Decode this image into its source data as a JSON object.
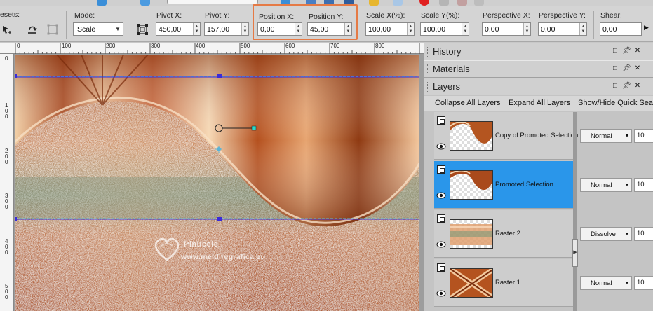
{
  "toolbar": {
    "presets_label": "esets:",
    "mode_label": "Mode:",
    "mode_value": "Scale",
    "fields": [
      {
        "label": "Pivot X:",
        "value": "450,00"
      },
      {
        "label": "Pivot Y:",
        "value": "157,00"
      },
      {
        "label": "Position X:",
        "value": "0,00"
      },
      {
        "label": "Position Y:",
        "value": "45,00"
      },
      {
        "label": "Scale X(%):",
        "value": "100,00"
      },
      {
        "label": "Scale Y(%):",
        "value": "100,00"
      },
      {
        "label": "Perspective X:",
        "value": "0,00"
      },
      {
        "label": "Perspective Y:",
        "value": "0,00"
      },
      {
        "label": "Shear:",
        "value": "0,00"
      }
    ]
  },
  "ruler": {
    "top_ticks": [
      "0",
      "100",
      "200",
      "300",
      "400",
      "500",
      "600",
      "700",
      "800"
    ],
    "left_ticks": [
      "0",
      "1 0 0",
      "2 0 0",
      "3 0 0",
      "4 0 0",
      "5 0 0"
    ]
  },
  "watermark": {
    "line1": "Pinuccie",
    "line2": "www.meidiregrafica.eu"
  },
  "panels": {
    "history": {
      "title": "History"
    },
    "materials": {
      "title": "Materials"
    },
    "layers": {
      "title": "Layers",
      "toolbar": {
        "collapse": "Collapse All Layers",
        "expand": "Expand All Layers",
        "quick_search": "Show/Hide Quick Sea"
      },
      "items": [
        {
          "name": "Copy of Promoted Selection",
          "blend": "Normal",
          "opacity": "10",
          "active": false
        },
        {
          "name": "Promoted Selection",
          "blend": "Normal",
          "opacity": "10",
          "active": true
        },
        {
          "name": "Raster 2",
          "blend": "Dissolve",
          "opacity": "10",
          "active": false
        },
        {
          "name": "Raster 1",
          "blend": "Normal",
          "opacity": "10",
          "active": false
        }
      ]
    }
  },
  "colors": {
    "highlight": "#e57a45",
    "active_layer": "#2a96ea",
    "handle": "#3b2bd8"
  }
}
